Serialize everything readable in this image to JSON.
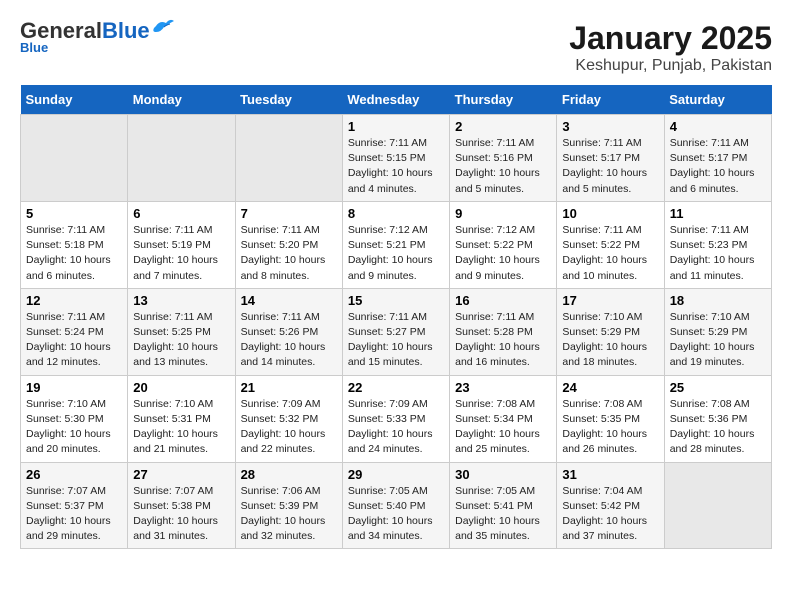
{
  "app": {
    "logo_general": "General",
    "logo_blue": "Blue",
    "title": "January 2025",
    "subtitle": "Keshupur, Punjab, Pakistan"
  },
  "calendar": {
    "headers": [
      "Sunday",
      "Monday",
      "Tuesday",
      "Wednesday",
      "Thursday",
      "Friday",
      "Saturday"
    ],
    "rows": [
      [
        {
          "num": "",
          "info": ""
        },
        {
          "num": "",
          "info": ""
        },
        {
          "num": "",
          "info": ""
        },
        {
          "num": "1",
          "info": "Sunrise: 7:11 AM\nSunset: 5:15 PM\nDaylight: 10 hours\nand 4 minutes."
        },
        {
          "num": "2",
          "info": "Sunrise: 7:11 AM\nSunset: 5:16 PM\nDaylight: 10 hours\nand 5 minutes."
        },
        {
          "num": "3",
          "info": "Sunrise: 7:11 AM\nSunset: 5:17 PM\nDaylight: 10 hours\nand 5 minutes."
        },
        {
          "num": "4",
          "info": "Sunrise: 7:11 AM\nSunset: 5:17 PM\nDaylight: 10 hours\nand 6 minutes."
        }
      ],
      [
        {
          "num": "5",
          "info": "Sunrise: 7:11 AM\nSunset: 5:18 PM\nDaylight: 10 hours\nand 6 minutes."
        },
        {
          "num": "6",
          "info": "Sunrise: 7:11 AM\nSunset: 5:19 PM\nDaylight: 10 hours\nand 7 minutes."
        },
        {
          "num": "7",
          "info": "Sunrise: 7:11 AM\nSunset: 5:20 PM\nDaylight: 10 hours\nand 8 minutes."
        },
        {
          "num": "8",
          "info": "Sunrise: 7:12 AM\nSunset: 5:21 PM\nDaylight: 10 hours\nand 9 minutes."
        },
        {
          "num": "9",
          "info": "Sunrise: 7:12 AM\nSunset: 5:22 PM\nDaylight: 10 hours\nand 9 minutes."
        },
        {
          "num": "10",
          "info": "Sunrise: 7:11 AM\nSunset: 5:22 PM\nDaylight: 10 hours\nand 10 minutes."
        },
        {
          "num": "11",
          "info": "Sunrise: 7:11 AM\nSunset: 5:23 PM\nDaylight: 10 hours\nand 11 minutes."
        }
      ],
      [
        {
          "num": "12",
          "info": "Sunrise: 7:11 AM\nSunset: 5:24 PM\nDaylight: 10 hours\nand 12 minutes."
        },
        {
          "num": "13",
          "info": "Sunrise: 7:11 AM\nSunset: 5:25 PM\nDaylight: 10 hours\nand 13 minutes."
        },
        {
          "num": "14",
          "info": "Sunrise: 7:11 AM\nSunset: 5:26 PM\nDaylight: 10 hours\nand 14 minutes."
        },
        {
          "num": "15",
          "info": "Sunrise: 7:11 AM\nSunset: 5:27 PM\nDaylight: 10 hours\nand 15 minutes."
        },
        {
          "num": "16",
          "info": "Sunrise: 7:11 AM\nSunset: 5:28 PM\nDaylight: 10 hours\nand 16 minutes."
        },
        {
          "num": "17",
          "info": "Sunrise: 7:10 AM\nSunset: 5:29 PM\nDaylight: 10 hours\nand 18 minutes."
        },
        {
          "num": "18",
          "info": "Sunrise: 7:10 AM\nSunset: 5:29 PM\nDaylight: 10 hours\nand 19 minutes."
        }
      ],
      [
        {
          "num": "19",
          "info": "Sunrise: 7:10 AM\nSunset: 5:30 PM\nDaylight: 10 hours\nand 20 minutes."
        },
        {
          "num": "20",
          "info": "Sunrise: 7:10 AM\nSunset: 5:31 PM\nDaylight: 10 hours\nand 21 minutes."
        },
        {
          "num": "21",
          "info": "Sunrise: 7:09 AM\nSunset: 5:32 PM\nDaylight: 10 hours\nand 22 minutes."
        },
        {
          "num": "22",
          "info": "Sunrise: 7:09 AM\nSunset: 5:33 PM\nDaylight: 10 hours\nand 24 minutes."
        },
        {
          "num": "23",
          "info": "Sunrise: 7:08 AM\nSunset: 5:34 PM\nDaylight: 10 hours\nand 25 minutes."
        },
        {
          "num": "24",
          "info": "Sunrise: 7:08 AM\nSunset: 5:35 PM\nDaylight: 10 hours\nand 26 minutes."
        },
        {
          "num": "25",
          "info": "Sunrise: 7:08 AM\nSunset: 5:36 PM\nDaylight: 10 hours\nand 28 minutes."
        }
      ],
      [
        {
          "num": "26",
          "info": "Sunrise: 7:07 AM\nSunset: 5:37 PM\nDaylight: 10 hours\nand 29 minutes."
        },
        {
          "num": "27",
          "info": "Sunrise: 7:07 AM\nSunset: 5:38 PM\nDaylight: 10 hours\nand 31 minutes."
        },
        {
          "num": "28",
          "info": "Sunrise: 7:06 AM\nSunset: 5:39 PM\nDaylight: 10 hours\nand 32 minutes."
        },
        {
          "num": "29",
          "info": "Sunrise: 7:05 AM\nSunset: 5:40 PM\nDaylight: 10 hours\nand 34 minutes."
        },
        {
          "num": "30",
          "info": "Sunrise: 7:05 AM\nSunset: 5:41 PM\nDaylight: 10 hours\nand 35 minutes."
        },
        {
          "num": "31",
          "info": "Sunrise: 7:04 AM\nSunset: 5:42 PM\nDaylight: 10 hours\nand 37 minutes."
        },
        {
          "num": "",
          "info": ""
        }
      ]
    ]
  }
}
